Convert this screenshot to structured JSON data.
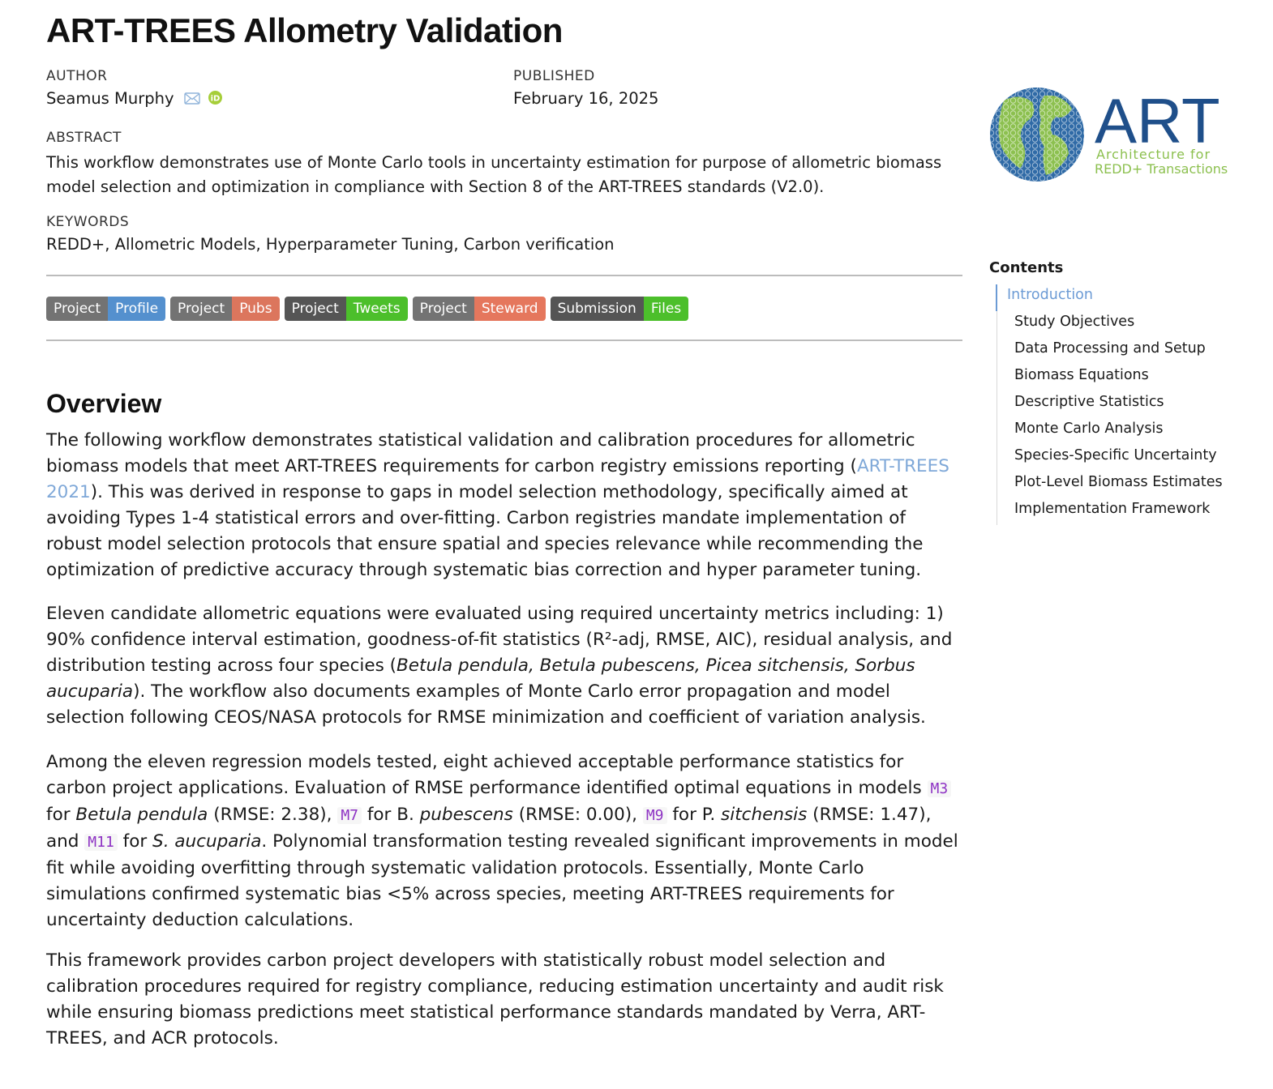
{
  "title": "ART-TREES Allometry Validation",
  "author": {
    "label": "AUTHOR",
    "name": "Seamus Murphy",
    "icons": [
      "mail-icon",
      "orcid-icon"
    ]
  },
  "published": {
    "label": "PUBLISHED",
    "date": "February 16, 2025"
  },
  "abstract": {
    "label": "ABSTRACT",
    "line1": "This workflow demonstrates use of Monte Carlo tools in uncertainty estimation for purpose of allometric biomass",
    "line2": "model selection and optimization in compliance with Section 8 of the ART-TREES standards (V2.0)."
  },
  "keywords": {
    "label": "KEYWORDS",
    "text": "REDD+, Allometric Models, Hyperparameter Tuning, Carbon verification"
  },
  "badges": [
    {
      "left": "Project",
      "right": "Profile",
      "color": "#2f78c4"
    },
    {
      "left": "Project",
      "right": "Pubs",
      "color": "#d5593a"
    },
    {
      "left": "Project",
      "right": "Tweets",
      "color": "#4cbf2b"
    },
    {
      "left": "Project",
      "right": "Steward",
      "color": "#e05a3a"
    },
    {
      "left": "Submission",
      "right": "Files",
      "color": "#4cbf2b"
    }
  ],
  "logo": {
    "wordmark": "ART",
    "tagline1": "Architecture for",
    "tagline2": "REDD+ Transactions",
    "primary_color": "#1f4f8a",
    "accent_color": "#8cc04f"
  },
  "toc": {
    "title": "Contents",
    "items": [
      "Introduction",
      "Study Objectives",
      "Data Processing and Setup",
      "Biomass Equations",
      "Descriptive Statistics",
      "Monte Carlo Analysis",
      "Species-Specific Uncertainty",
      "Plot-Level Biomass Estimates",
      "Implementation Framework"
    ],
    "active": "Introduction"
  },
  "overview": {
    "heading": "Overview",
    "p1": {
      "a": "The following workflow demonstrates statistical validation and calibration procedures for allometric biomass models that meet ART-TREES requirements for carbon registry emissions reporting (",
      "link": "ART-TREES 2021",
      "b": "). This was derived in response to gaps in model selection methodology, specifically aimed at avoiding Types 1-4 statistical errors and over-fitting. Carbon registries mandate implementation of robust model selection protocols that ensure spatial and species relevance while recommending the optimization of predictive accuracy through systematic bias correction and hyper parameter tuning."
    },
    "p2": {
      "a": "Eleven candidate allometric equations were evaluated using required uncertainty metrics including: 1) 90% confidence interval estimation, goodness-of-fit statistics (R²-adj, RMSE, AIC), residual analysis, and distribution testing across four species (",
      "species": "Betula pendula, Betula pubescens, Picea sitchensis, Sorbus aucuparia",
      "b": "). The workflow also documents examples of Monte Carlo error propagation and model selection following CEOS/NASA protocols for RMSE minimization and coefficient of variation analysis."
    },
    "p3": {
      "t1": "Among the eleven regression models tested, eight achieved acceptable performance statistics for carbon project applications. Evaluation of RMSE performance identified optimal equations in models ",
      "m3": "M3",
      "t2": " for ",
      "s1": "Betula pendula",
      "t3": " (RMSE: 2.38), ",
      "m7": "M7",
      "t4": " for B. ",
      "s2": "pubescens",
      "t5": " (RMSE: 0.00), ",
      "m9": "M9",
      "t6": " for P. ",
      "s3": "sitchensis",
      "t7": " (RMSE: 1.47), and ",
      "m11": "M11",
      "t8": " for ",
      "s4": "S. aucuparia",
      "t9": ". Polynomial transformation testing revealed significant improvements in model fit while avoiding overfitting through systematic validation protocols. Essentially, Monte Carlo simulations confirmed systematic bias <5% across species, meeting ART-TREES requirements for uncertainty deduction calculations."
    },
    "p4": "This framework provides carbon project developers with statistically robust model selection and calibration procedures required for registry compliance, reducing estimation uncertainty and audit risk while ensuring biomass predictions meet statistical performance standards mandated by Verra, ART-TREES, and ACR protocols."
  }
}
